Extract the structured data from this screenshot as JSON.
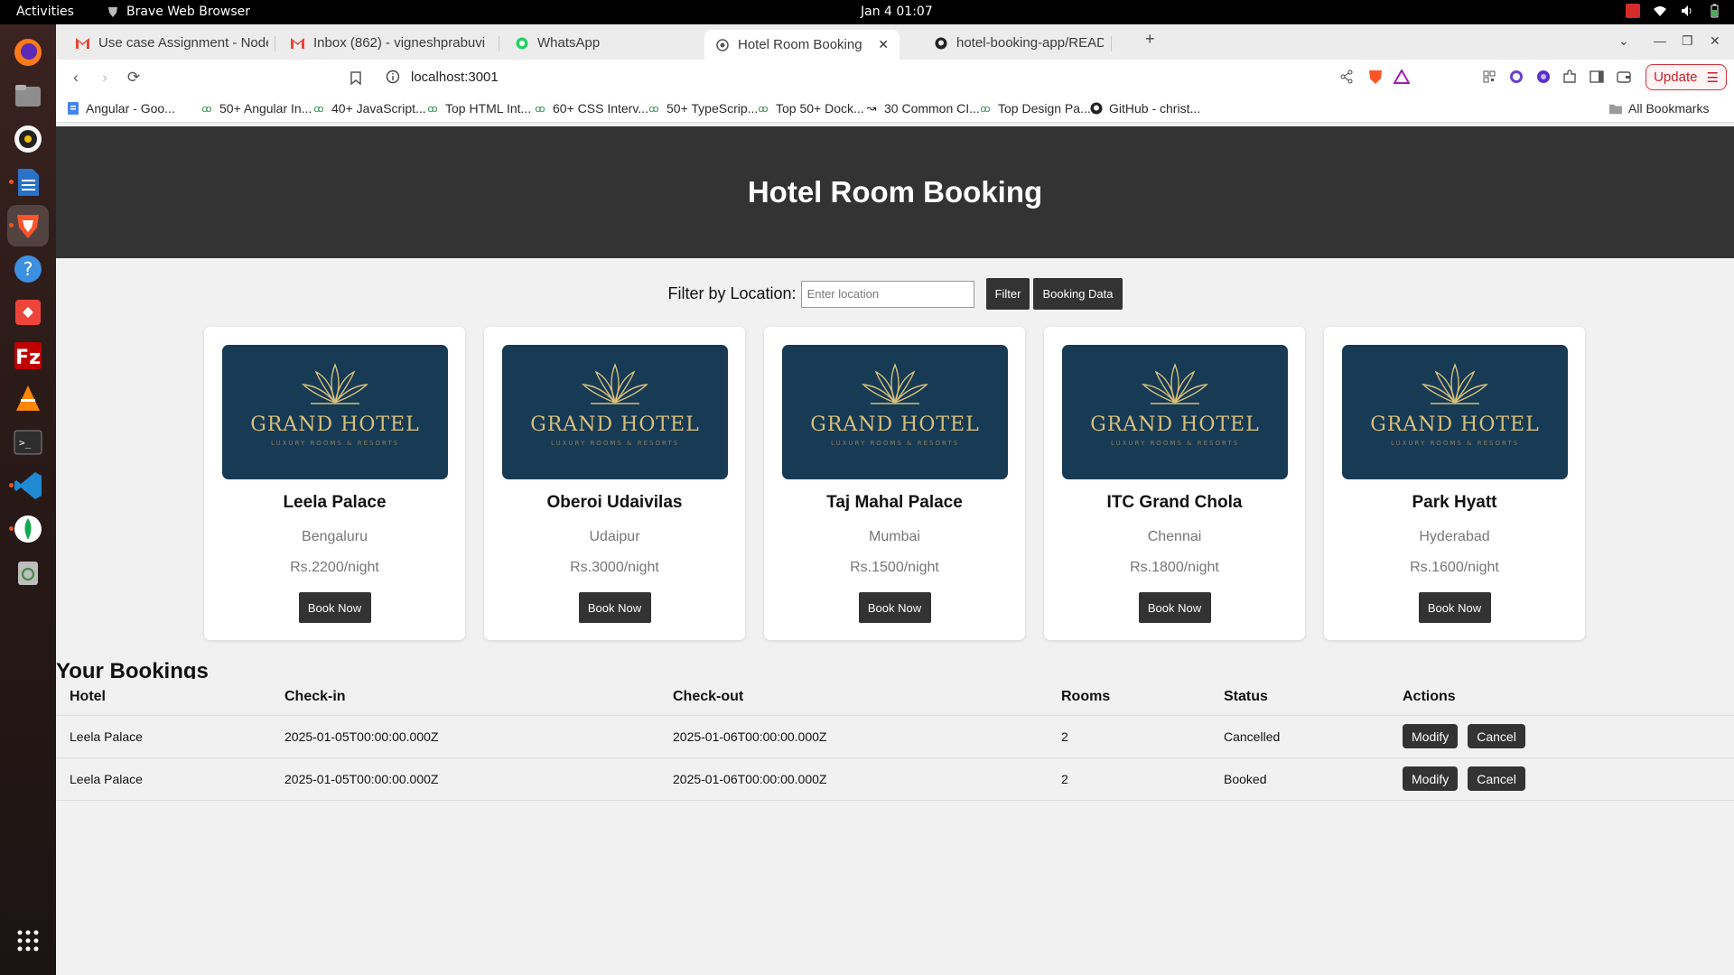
{
  "os": {
    "activities": "Activities",
    "app_name": "Brave Web Browser",
    "clock": "Jan 4  01:07"
  },
  "tabs": [
    {
      "title": "Use case Assignment - Node",
      "icon": "gmail-icon"
    },
    {
      "title": "Inbox (862) - vigneshprabuvi",
      "icon": "gmail-icon"
    },
    {
      "title": "WhatsApp",
      "icon": "whatsapp-icon"
    },
    {
      "title": "Hotel Room Booking",
      "icon": "globe-icon",
      "active": true
    },
    {
      "title": "hotel-booking-app/README",
      "icon": "github-icon"
    }
  ],
  "address_bar": {
    "url": "localhost:3001"
  },
  "update_button": "Update",
  "bookmarks": [
    "Angular - Goo...",
    "50+ Angular In...",
    "40+ JavaScript...",
    "Top HTML Int...",
    "60+ CSS Interv...",
    "50+ TypeScrip...",
    "Top 50+ Dock...",
    "30 Common CI...",
    "Top Design Pa...",
    "GitHub - christ..."
  ],
  "all_bookmarks": "All Bookmarks",
  "page": {
    "title": "Hotel Room Booking",
    "filter_label": "Filter by Location:",
    "filter_placeholder": "Enter location",
    "filter_button": "Filter",
    "booking_data_button": "Booking Data",
    "hotel_image_brand": "GRAND HOTEL",
    "hotel_image_tagline": "LUXURY ROOMS & RESORTS",
    "book_now_label": "Book Now",
    "hotels": [
      {
        "name": "Leela Palace",
        "location": "Bengaluru",
        "price": "Rs.2200/night"
      },
      {
        "name": "Oberoi Udaivilas",
        "location": "Udaipur",
        "price": "Rs.3000/night"
      },
      {
        "name": "Taj Mahal Palace",
        "location": "Mumbai",
        "price": "Rs.1500/night"
      },
      {
        "name": "ITC Grand Chola",
        "location": "Chennai",
        "price": "Rs.1800/night"
      },
      {
        "name": "Park Hyatt",
        "location": "Hyderabad",
        "price": "Rs.1600/night"
      }
    ],
    "bookings_title": "Your Bookings",
    "bookings_columns": [
      "Hotel",
      "Check-in",
      "Check-out",
      "Rooms",
      "Status",
      "Actions"
    ],
    "bookings": [
      {
        "hotel": "Leela Palace",
        "check_in": "2025-01-05T00:00:00.000Z",
        "check_out": "2025-01-06T00:00:00.000Z",
        "rooms": "2",
        "status": "Cancelled"
      },
      {
        "hotel": "Leela Palace",
        "check_in": "2025-01-05T00:00:00.000Z",
        "check_out": "2025-01-06T00:00:00.000Z",
        "rooms": "2",
        "status": "Booked"
      }
    ],
    "modify_label": "Modify",
    "cancel_label": "Cancel"
  },
  "colors": {
    "header_bg": "#333333",
    "hotel_image_bg": "#173a55",
    "gold": "#d8c07a",
    "update_red": "#c2222c"
  }
}
